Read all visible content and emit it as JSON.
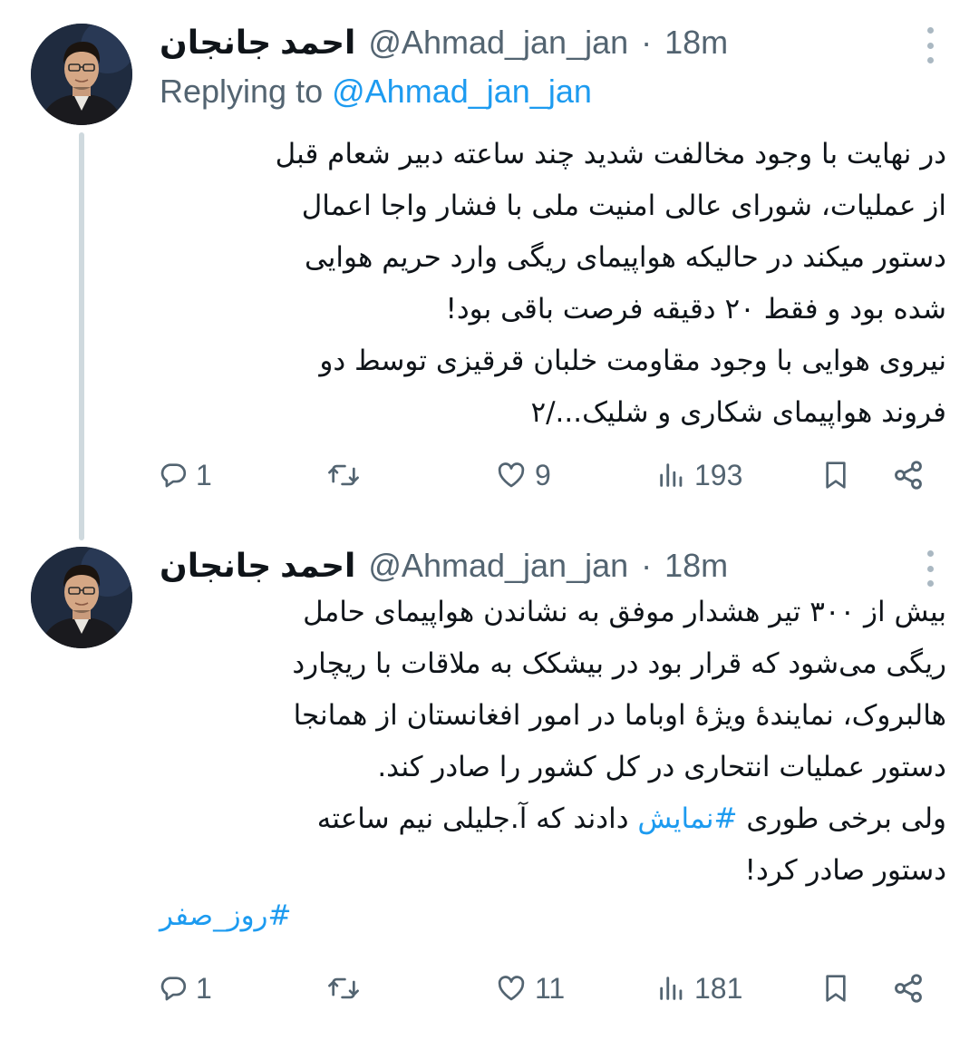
{
  "tweets": [
    {
      "author": {
        "name": "احمد جانجان",
        "handle": "@Ahmad_jan_jan",
        "dot": "·",
        "time": "18m"
      },
      "replying_prefix": "Replying to",
      "replying_to": "@Ahmad_jan_jan",
      "lines": [
        "در نهایت با وجود مخالفت شدید چند ساعته دبیر شعام قبل",
        "از عملیات، شورای عالی امنیت ملی با فشار واجا اعمال",
        "دستور میکند در حالیکه هواپیمای ریگی وارد حریم هوایی",
        "شده بود و فقط ۲۰ دقیقه فرصت باقی بود!",
        "نیروی هوایی با وجود مقاومت خلبان قرقیزی توسط دو",
        "فروند هواپیمای شکاری و شلیک.../۲"
      ],
      "stats": {
        "replies": "1",
        "retweets": "",
        "likes": "9",
        "views": "193"
      }
    },
    {
      "author": {
        "name": "احمد جانجان",
        "handle": "@Ahmad_jan_jan",
        "dot": "·",
        "time": "18m"
      },
      "lines": [
        "بیش از ۳۰۰ تیر هشدار موفق به نشاندن هواپیمای حامل",
        "ریگی می‌شود که قرار بود در بیشکک به ملاقات با ریچارد",
        "هالبروک، نمایندهٔ ویژهٔ اوباما در امور افغانستان از همانجا",
        "دستور عملیات انتحاری در کل کشور را صادر کند."
      ],
      "line5_before": "ولی برخی طوری",
      "line5_hashtag": "#نمایش",
      "line5_after": "دادند که آ.جلیلی نیم ساعته",
      "line6": "دستور صادر کرد!",
      "hashtag_line": "#روز_صفر",
      "stats": {
        "replies": "1",
        "retweets": "",
        "likes": "11",
        "views": "181"
      }
    }
  ],
  "icons": {
    "reply": "reply-icon",
    "retweet": "retweet-icon",
    "like": "heart-icon",
    "views": "views-icon",
    "bookmark": "bookmark-icon",
    "share": "share-icon",
    "more": "more-icon"
  },
  "colors": {
    "text": "#0f1419",
    "secondary": "#536471",
    "accent": "#1d9bf0",
    "thread_line": "#cfd9de"
  }
}
